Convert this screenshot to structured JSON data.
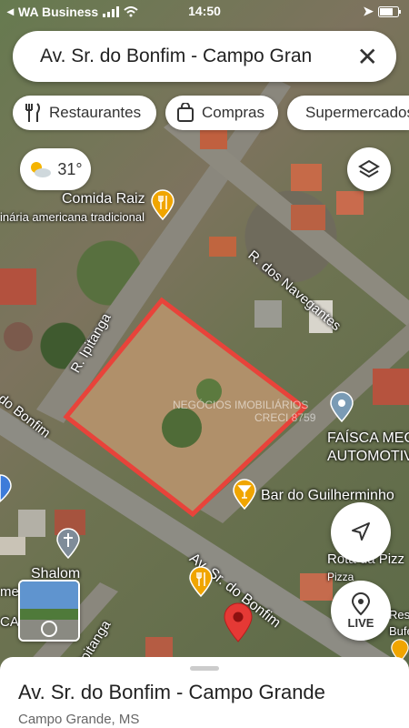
{
  "status_bar": {
    "carrier": "WA Business",
    "time": "14:50"
  },
  "search": {
    "query": "Av. Sr. do Bonfim - Campo Grande"
  },
  "chips": [
    {
      "label": "Restaurantes",
      "icon": "fork-knife-icon"
    },
    {
      "label": "Compras",
      "icon": "shopping-bag-icon"
    },
    {
      "label": "Supermercados",
      "icon": "cart-icon"
    }
  ],
  "weather": {
    "temp": "31°",
    "icon": "partly-sunny-icon"
  },
  "map": {
    "street_labels": [
      "R. dos Navegantes",
      "R. Ipitanga",
      "do Bonfim",
      "Av. Sr. do Bonfim",
      "Ipitanga"
    ],
    "places": {
      "comida_raiz_name": "Comida Raiz",
      "comida_raiz_desc": "inária americana tradicional",
      "faisca_line1": "FAÍSCA MEC",
      "faisca_line2": "AUTOMOTIV",
      "bar": "Bar do Guilherminho",
      "rota_line1": "Rota da Pizz",
      "rota_line2": "Pizza",
      "shalom": "Shalom",
      "bufe_line1": "Resi",
      "bufe_line2": "Bufe",
      "left_edge_1": "me",
      "left_edge_2": "CAS"
    },
    "watermark_line1": "NEGÓCIOS IMOBILIÁRIOS",
    "watermark_line2": "CRECI 8759"
  },
  "controls": {
    "live_label": "LIVE"
  },
  "sheet": {
    "title": "Av. Sr. do Bonfim - Campo Grande",
    "subtitle": "Campo Grande, MS"
  },
  "colors": {
    "highlight": "#e8433a",
    "pin_red": "#e53935",
    "pin_orange": "#f0a500"
  }
}
